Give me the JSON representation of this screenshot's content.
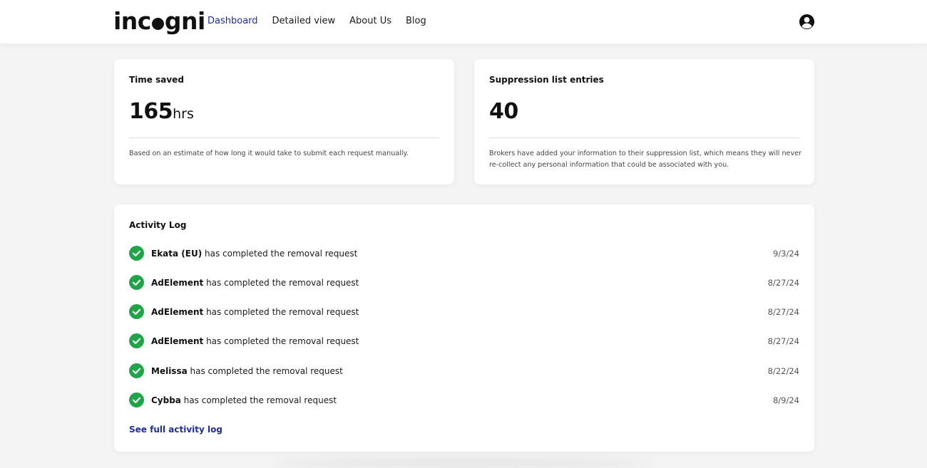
{
  "brand": {
    "logo_pre": "inc",
    "logo_post": "gni"
  },
  "nav": {
    "items": [
      {
        "label": "Dashboard",
        "active": true
      },
      {
        "label": "Detailed view",
        "active": false
      },
      {
        "label": "About Us",
        "active": false
      },
      {
        "label": "Blog",
        "active": false
      }
    ]
  },
  "stats": {
    "time_saved": {
      "label": "Time saved",
      "value": "165",
      "unit": "hrs",
      "description": "Based on an estimate of how long it would take to submit each request manually."
    },
    "suppression": {
      "label": "Suppression list entries",
      "value": "40",
      "description": "Brokers have added your information to their suppression list, which means they will never re-collect any personal information that could be associated with you."
    }
  },
  "activity": {
    "title": "Activity Log",
    "rows": [
      {
        "broker": "Ekata (EU)",
        "text": " has completed the removal request",
        "date": "9/3/24"
      },
      {
        "broker": "AdElement",
        "text": " has completed the removal request",
        "date": "8/27/24"
      },
      {
        "broker": "AdElement",
        "text": " has completed the removal request",
        "date": "8/27/24"
      },
      {
        "broker": "AdElement",
        "text": " has completed the removal request",
        "date": "8/27/24"
      },
      {
        "broker": "Melissa",
        "text": " has completed the removal request",
        "date": "8/22/24"
      },
      {
        "broker": "Cybba",
        "text": " has completed the removal request",
        "date": "8/9/24"
      }
    ],
    "full_log_label": "See full activity log"
  },
  "colors": {
    "accent": "#1f2d9e",
    "check_green": "#1fa547",
    "background": "#f4f4f5"
  },
  "icons": {
    "avatar": "user-circle-icon",
    "check": "check-circle-icon"
  }
}
